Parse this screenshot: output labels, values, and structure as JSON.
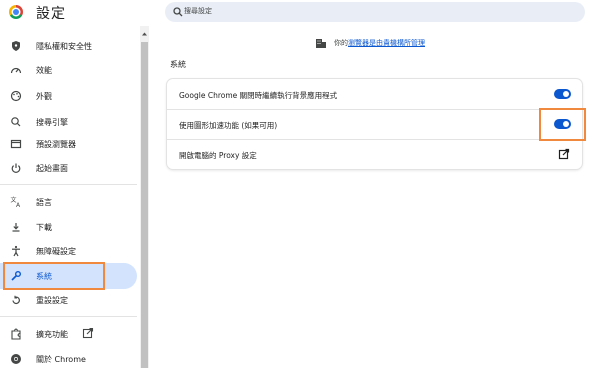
{
  "header": {
    "title": "設定",
    "search_placeholder": "搜尋設定"
  },
  "sidebar": {
    "items": [
      {
        "label": "隱私權和安全性",
        "icon": "shield-icon"
      },
      {
        "label": "效能",
        "icon": "speedometer-icon"
      },
      {
        "label": "外觀",
        "icon": "palette-icon"
      },
      {
        "label": "搜尋引擎",
        "icon": "search-icon"
      },
      {
        "label": "預設瀏覽器",
        "icon": "browser-window-icon"
      },
      {
        "label": "起始畫面",
        "icon": "power-icon"
      },
      {
        "label": "語言",
        "icon": "translate-icon"
      },
      {
        "label": "下載",
        "icon": "download-icon"
      },
      {
        "label": "無障礙設定",
        "icon": "accessibility-icon"
      },
      {
        "label": "系統",
        "icon": "wrench-icon",
        "active": true
      },
      {
        "label": "重設設定",
        "icon": "reset-icon"
      },
      {
        "label": "擴充功能",
        "icon": "puzzle-icon"
      },
      {
        "label": "關於 Chrome",
        "icon": "chrome-icon"
      }
    ]
  },
  "main": {
    "managed_prefix": "你的",
    "managed_link": "瀏覽器是由貴機構所管理",
    "section_title": "系統",
    "rows": [
      {
        "label": "Google Chrome 關閉時繼續執行背景應用程式",
        "control": "toggle",
        "on": true
      },
      {
        "label": "使用圖形加速功能 (如果可用)",
        "control": "toggle",
        "on": true
      },
      {
        "label": "開啟電腦的 Proxy 設定",
        "control": "launch-icon"
      }
    ]
  },
  "colors": {
    "accent": "#0b57d0",
    "active_bg": "#d3e3fd",
    "highlight": "#f0883e"
  }
}
